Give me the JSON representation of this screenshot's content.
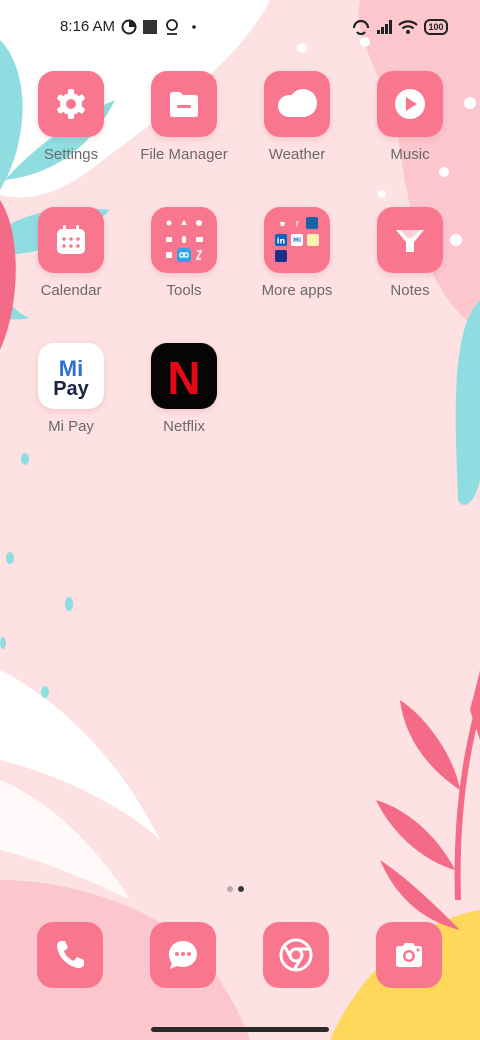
{
  "status_bar": {
    "time": "8:16 AM",
    "battery_level": "100",
    "icons": [
      "data-saver-icon",
      "square-notification-icon",
      "location-pin-icon",
      "dot-icon",
      "hotspot-icon",
      "signal-icon",
      "wifi-icon",
      "battery-icon"
    ]
  },
  "apps": [
    {
      "label": "Settings",
      "icon": "gear-icon"
    },
    {
      "label": "File Manager",
      "icon": "folder-icon"
    },
    {
      "label": "Weather",
      "icon": "cloud-icon"
    },
    {
      "label": "Music",
      "icon": "play-icon"
    },
    {
      "label": "Calendar",
      "icon": "calendar-icon"
    },
    {
      "label": "Tools",
      "icon": "tools-folder-icon"
    },
    {
      "label": "More apps",
      "icon": "apps-folder-icon"
    },
    {
      "label": "Notes",
      "icon": "funnel-note-icon"
    },
    {
      "label": "Mi Pay",
      "icon": "mi-pay-logo"
    },
    {
      "label": "Netflix",
      "icon": "netflix-logo"
    }
  ],
  "logos": {
    "mi_pay_top": "Mi",
    "mi_pay_bottom": "Pay",
    "netflix": "N"
  },
  "page_indicator": {
    "pages": 2,
    "current": 2
  },
  "dock": [
    {
      "icon": "phone-icon"
    },
    {
      "icon": "message-icon"
    },
    {
      "icon": "chrome-icon"
    },
    {
      "icon": "camera-icon"
    }
  ],
  "colors": {
    "tile": "#f8778f",
    "background": "#fde1e3",
    "accent_teal": "#8fdde0",
    "accent_yellow": "#ffd75a",
    "label": "#6a6a6a"
  }
}
